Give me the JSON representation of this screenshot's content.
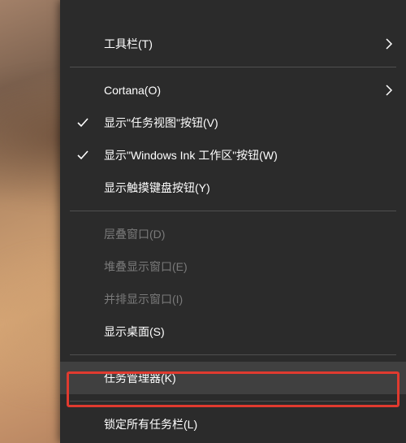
{
  "menu": {
    "items": [
      {
        "label": "工具栏(T)",
        "submenu": true
      },
      {
        "label": "Cortana(O)",
        "submenu": true
      },
      {
        "label": "显示\"任务视图\"按钮(V)",
        "checked": true
      },
      {
        "label": "显示\"Windows Ink 工作区\"按钮(W)",
        "checked": true
      },
      {
        "label": "显示触摸键盘按钮(Y)"
      },
      {
        "label": "层叠窗口(D)",
        "disabled": true
      },
      {
        "label": "堆叠显示窗口(E)",
        "disabled": true
      },
      {
        "label": "并排显示窗口(I)",
        "disabled": true
      },
      {
        "label": "显示桌面(S)"
      },
      {
        "label": "任务管理器(K)",
        "hovered": true,
        "highlighted": true
      },
      {
        "label": "锁定所有任务栏(L)"
      }
    ]
  }
}
